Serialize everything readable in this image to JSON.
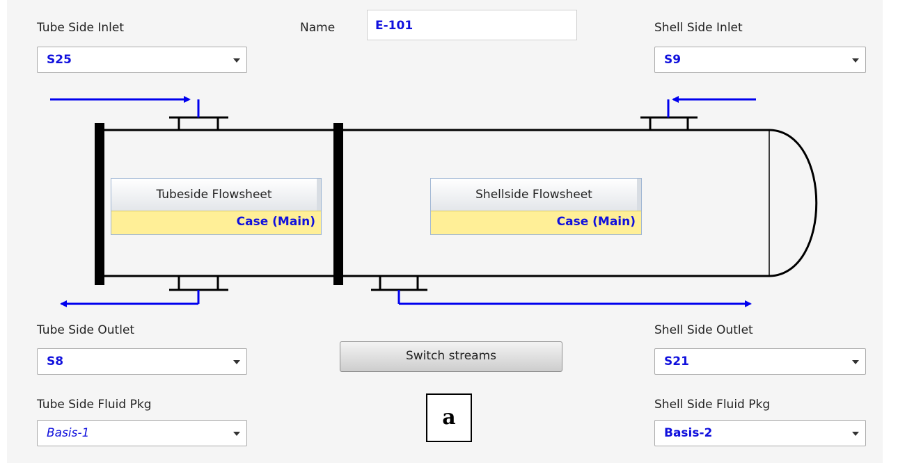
{
  "header": {
    "name_label": "Name",
    "name_value": "E-101"
  },
  "tube_side": {
    "inlet_label": "Tube Side Inlet",
    "inlet_value": "S25",
    "outlet_label": "Tube Side Outlet",
    "outlet_value": "S8",
    "fluid_pkg_label": "Tube Side Fluid Pkg",
    "fluid_pkg_value": "Basis-1",
    "flowsheet_title": "Tubeside Flowsheet",
    "flowsheet_case": "Case (Main)"
  },
  "shell_side": {
    "inlet_label": "Shell Side Inlet",
    "inlet_value": "S9",
    "outlet_label": "Shell Side Outlet",
    "outlet_value": "S21",
    "fluid_pkg_label": "Shell Side Fluid Pkg",
    "fluid_pkg_value": "Basis-2",
    "flowsheet_title": "Shellside Flowsheet",
    "flowsheet_case": "Case (Main)"
  },
  "actions": {
    "switch_label": "Switch streams"
  },
  "tag": "a",
  "colors": {
    "stream_arrow": "#0000ee",
    "value_text": "#1010dd",
    "case_background": "#ffef97",
    "panel_background": "#f5f5f5"
  }
}
